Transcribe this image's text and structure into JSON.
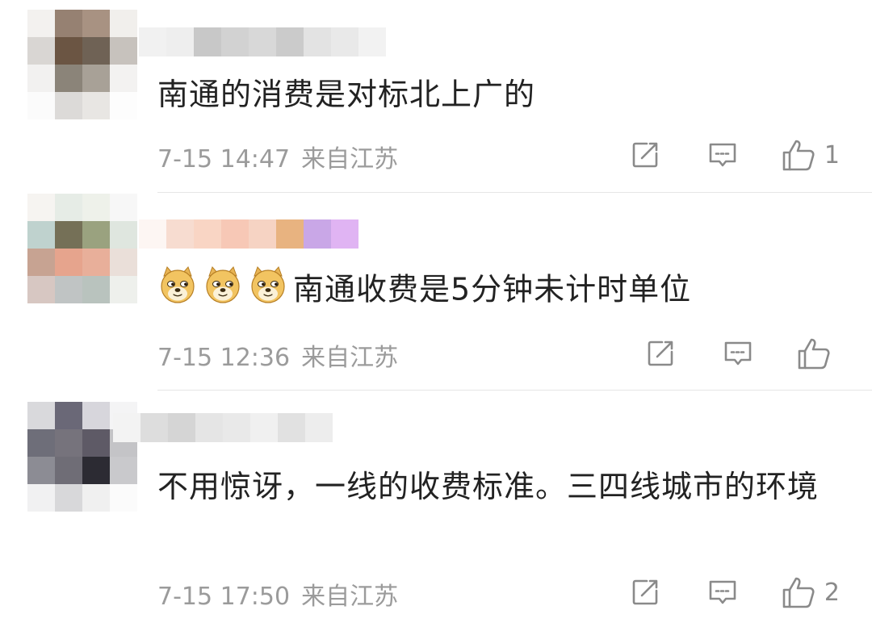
{
  "comments": [
    {
      "text": "南通的消费是对标北上广的",
      "emojis": [],
      "time": "7-15 14:47",
      "location": "来自江苏",
      "likes": "1",
      "avatar_colors": [
        "#f3f1ef",
        "#968172",
        "#a89282",
        "#f1efec",
        "#d9d6d3",
        "#6b5543",
        "#6f6255",
        "#c7c2bd",
        "#f2f1f0",
        "#8b8479",
        "#a8a197",
        "#f3f2f1",
        "#fbfbfb",
        "#dcdad8",
        "#e8e6e3",
        "#fdfdfd"
      ],
      "name_colors": [
        "#f1f1f1",
        "#eeeeee",
        "#c8c8c8",
        "#d2d2d2",
        "#d8d8d8",
        "#cbcbcb",
        "#e3e3e3",
        "#e9e9e9",
        "#f2f2f2"
      ]
    },
    {
      "text": "南通收费是5分钟未计时单位",
      "emojis": [
        "doge",
        "doge",
        "doge"
      ],
      "time": "7-15 12:36",
      "location": "来自江苏",
      "likes": "",
      "avatar_colors": [
        "#f6f4f1",
        "#e6ece6",
        "#eef1ea",
        "#f7f7f7",
        "#bfd2ce",
        "#757057",
        "#9aa27f",
        "#dfe6df",
        "#c7a392",
        "#e6a48d",
        "#e8af9a",
        "#eadfd9",
        "#d7c7c2",
        "#c0c4c4",
        "#b9c3be",
        "#eef0ec"
      ],
      "name_colors": [
        "#fdf6f3",
        "#f7dcd0",
        "#f9d5c4",
        "#f7c8b6",
        "#f6d3c3",
        "#e8b380",
        "#c9a7e7",
        "#e0b4f3"
      ]
    },
    {
      "text": "不用惊讶，一线的收费标准。三四线城市的环境",
      "emojis": [],
      "time": "7-15 17:50",
      "location": "来自江苏",
      "likes": "2",
      "avatar_colors": [
        "#d9d9dc",
        "#6a6877",
        "#d7d6dc",
        "#f4f4f5",
        "#6e6e79",
        "#76737c",
        "#5e5a66",
        "#c4c4c7",
        "#8c8c94",
        "#6f6d76",
        "#2c2b33",
        "#c9c9cc",
        "#f1f1f2",
        "#d8d8da",
        "#f0f0f0",
        "#fbfbfb"
      ],
      "name_colors": [
        "#f3f3f3",
        "#dddddd",
        "#d5d5d5",
        "#e5e5e5",
        "#e9e9e9",
        "#f0f0f0",
        "#e1e1e1",
        "#ededed"
      ]
    }
  ],
  "icons": {
    "share": "share-icon",
    "reply": "reply-icon",
    "like": "thumbs-up-icon",
    "emoji": "doge-emoji"
  },
  "colors": {
    "text": "#222222",
    "meta": "#9b9b9b",
    "icon": "#8a8a8a",
    "divider": "#e6e6e6"
  }
}
